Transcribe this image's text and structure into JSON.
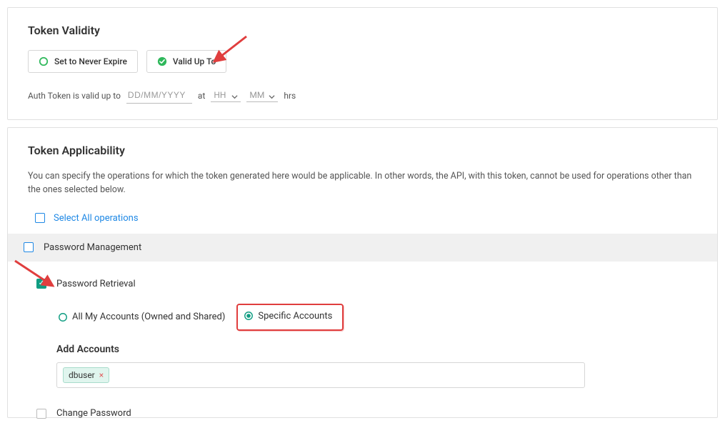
{
  "validity": {
    "title": "Token Validity",
    "never_expire_label": "Set to Never Expire",
    "valid_up_to_label": "Valid Up To",
    "line_prefix": "Auth Token is valid up to",
    "date_placeholder": "DD/MM/YYYY",
    "at_label": "at",
    "hh_label": "HH",
    "mm_label": "MM",
    "hrs_label": "hrs"
  },
  "applicability": {
    "title": "Token Applicability",
    "description": "You can specify the operations for which the token generated here would be applicable. In other words, the API, with this token, cannot be used for operations other than the ones selected below.",
    "select_all_label": "Select All operations",
    "section_pwd_mgmt": "Password Management",
    "item_pwd_retrieval": "Password Retrieval",
    "radio_all_accounts": "All My Accounts (Owned and Shared)",
    "radio_specific": "Specific Accounts",
    "add_accounts_title": "Add Accounts",
    "tag_value": "dbuser",
    "item_change_pwd": "Change Password"
  }
}
